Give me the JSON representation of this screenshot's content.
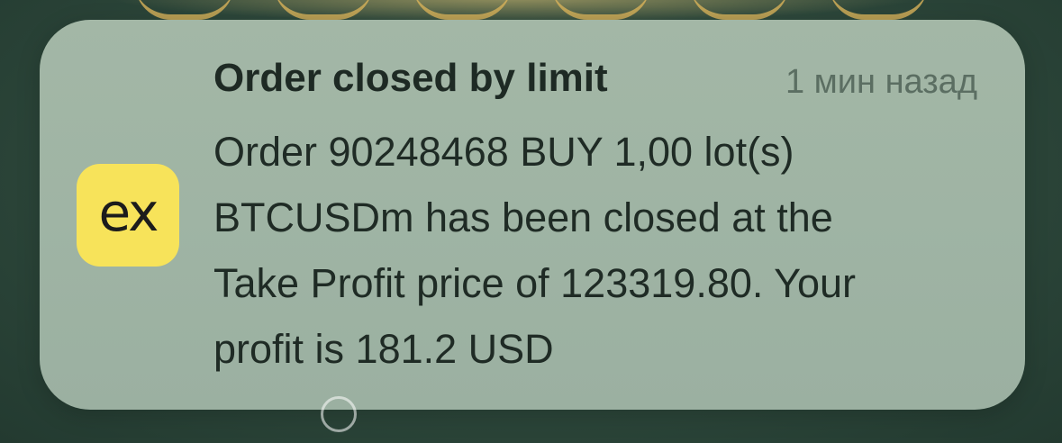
{
  "notification": {
    "app_icon_label": "ex",
    "title": "Order closed by limit",
    "time": "1 мин назад",
    "body_lines": [
      "Order 90248468 BUY 1,00 lot(s)",
      "BTCUSDm has been closed at the",
      "Take Profit price of 123319.80. Your",
      "profit is 181.2 USD"
    ]
  },
  "colors": {
    "app_icon_background": "#f7e35a",
    "notification_background": "#a3b7a6",
    "wallpaper": "#2f4a3d"
  }
}
